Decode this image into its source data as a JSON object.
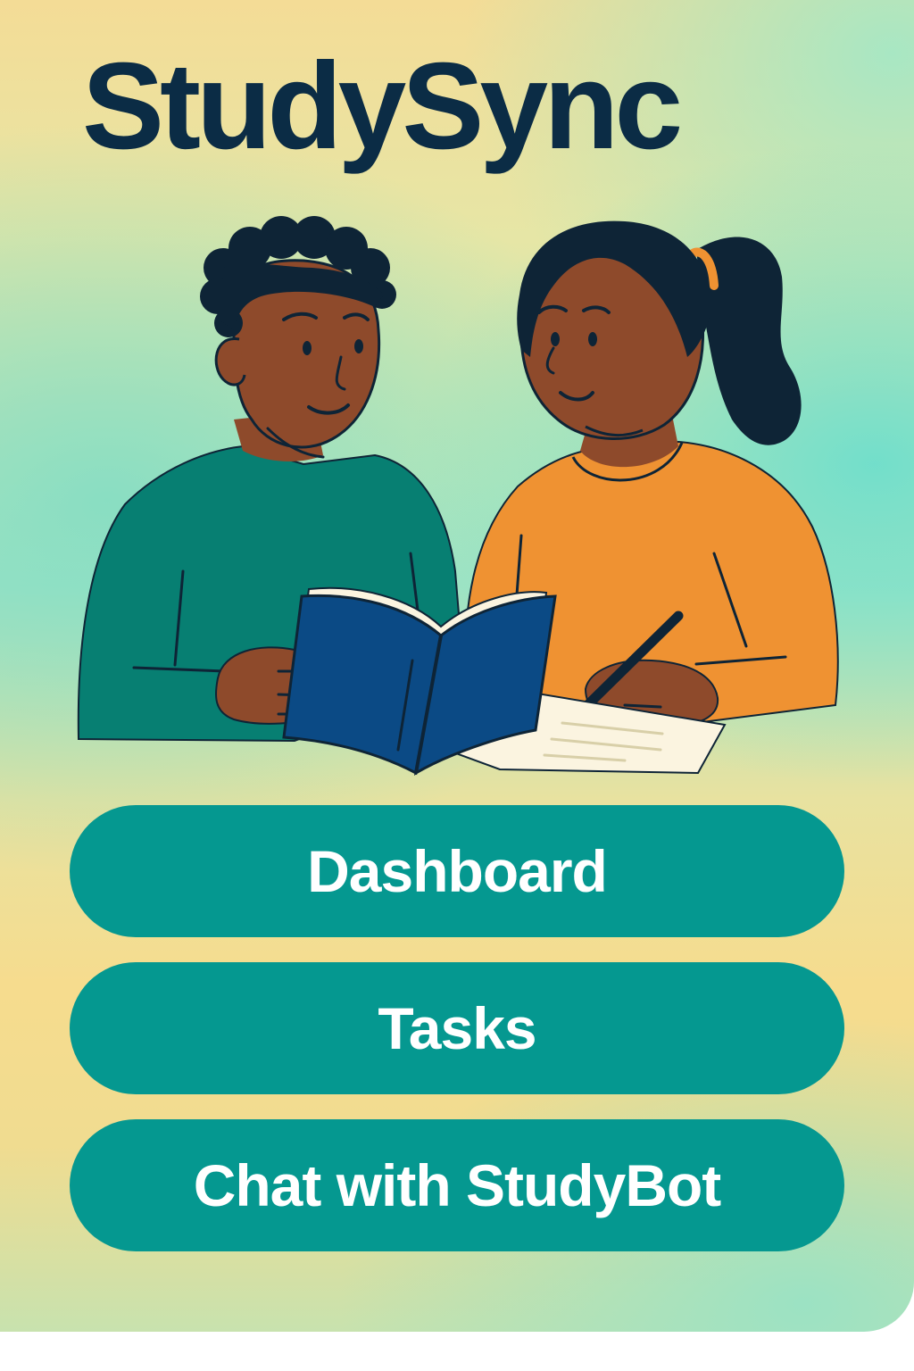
{
  "app": {
    "title": "StudySync"
  },
  "hero": {
    "icon": "students-studying-illustration"
  },
  "nav": {
    "items": [
      {
        "label": "Dashboard"
      },
      {
        "label": "Tasks"
      },
      {
        "label": "Chat with StudyBot"
      }
    ]
  },
  "colors": {
    "title": "#0b2c45",
    "button": "#059890",
    "button_text": "#ffffff",
    "shirt_left": "#077f72",
    "shirt_right": "#ef9232",
    "book": "#0b4a85",
    "skin": "#8e4a2b",
    "hair": "#0e2436"
  }
}
